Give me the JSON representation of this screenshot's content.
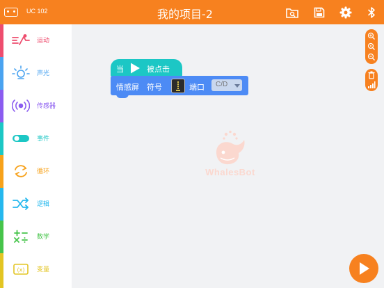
{
  "header": {
    "device_label": "UC 102",
    "title": "我的项目-2",
    "background": "#f7811f",
    "icons": [
      "folder-search-icon",
      "save-icon",
      "gear-icon",
      "bluetooth-icon"
    ]
  },
  "sidebar": {
    "items": [
      {
        "label": "运动",
        "color": "#ee4d6e",
        "icon": "motion-icon"
      },
      {
        "label": "声光",
        "color": "#4aa3f0",
        "icon": "sound-light-icon"
      },
      {
        "label": "传感器",
        "color": "#8b5cf0",
        "icon": "sensor-icon"
      },
      {
        "label": "事件",
        "color": "#1cc7c5",
        "icon": "toggle-icon"
      },
      {
        "label": "循环",
        "color": "#f7a21b",
        "icon": "loop-icon"
      },
      {
        "label": "逻辑",
        "color": "#25b8ee",
        "icon": "logic-icon"
      },
      {
        "label": "数学",
        "color": "#46c44a",
        "icon": "math-icon"
      },
      {
        "label": "变量",
        "color": "#e3c523",
        "icon": "variable-icon"
      }
    ]
  },
  "workspace": {
    "hat_block": {
      "prefix": "当",
      "suffix": "被点击",
      "color": "#1cc7c5"
    },
    "statement_block": {
      "label": "情感屏",
      "symbol_label": "符号",
      "port_label": "端口",
      "port_value": "C/D",
      "color": "#4d8bf5"
    },
    "watermark_text": "WhalesBot"
  }
}
